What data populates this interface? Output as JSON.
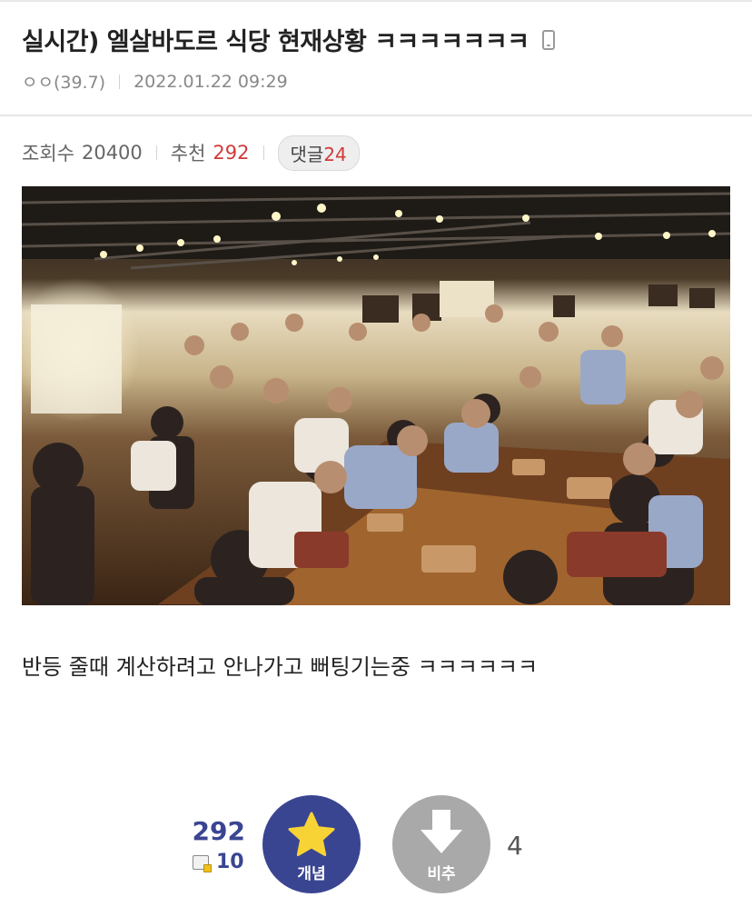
{
  "post": {
    "title": "실시간) 엘살바도르 식당 현재상황 ㅋㅋㅋㅋㅋㅋㅋ",
    "author": "ㅇㅇ(39.7)",
    "datetime": "2022.01.22 09:29",
    "body": "반등 줄때 계산하려고 안나가고 뻐팅기는중 ㅋㅋㅋㅋㅋㅋ"
  },
  "stats": {
    "views_label": "조회수",
    "views": "20400",
    "recommend_label": "추천",
    "recommend": "292",
    "comments_label": "댓글",
    "comments": "24"
  },
  "vote": {
    "up_count": "292",
    "fixed_count": "10",
    "up_label": "개념",
    "down_label": "비추",
    "down_count": "4"
  },
  "icons": {
    "device": "mobile-phone-icon",
    "up": "star-icon",
    "down": "down-arrow-icon",
    "fixed": "fixed-recommend-icon"
  },
  "colors": {
    "accent": "#3a4592",
    "highlight": "#d03a3a",
    "downvote": "#a9a9a9"
  }
}
